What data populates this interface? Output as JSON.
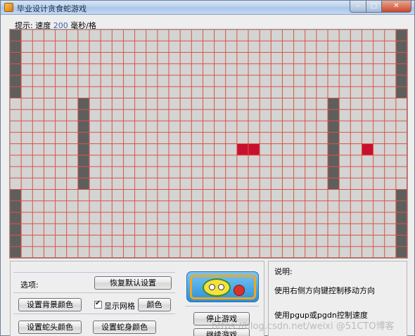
{
  "window": {
    "title": "毕业设计贪食蛇游戏",
    "min_label": "–",
    "max_label": "□",
    "close_label": "✕"
  },
  "status": {
    "prefix": "提示:",
    "speed_label": "速度",
    "speed_value": "200",
    "unit": "毫秒/格"
  },
  "board": {
    "cols": 35,
    "rows": 20,
    "background": "#d4d4d4",
    "grid_color": "#d75545",
    "wall_color": "#5e5e5e",
    "food_color": "#c8102e",
    "show_grid": true,
    "walls": [
      {
        "col": 0,
        "row_start": 0,
        "row_end": 5
      },
      {
        "col": 34,
        "row_start": 0,
        "row_end": 5
      },
      {
        "col": 0,
        "row_start": 14,
        "row_end": 19
      },
      {
        "col": 34,
        "row_start": 14,
        "row_end": 19
      },
      {
        "col": 6,
        "row_start": 6,
        "row_end": 13
      },
      {
        "col": 28,
        "row_start": 6,
        "row_end": 13
      }
    ],
    "red_cells": [
      {
        "col": 20,
        "row": 10
      },
      {
        "col": 21,
        "row": 10
      },
      {
        "col": 31,
        "row": 10
      }
    ]
  },
  "options": {
    "title": "选项:",
    "restore_default": "恢复默认设置",
    "set_bg_color": "设置背景颜色",
    "show_grid_label": "显示网格",
    "color_button": "颜色",
    "set_head_color": "设置蛇头颜色",
    "set_body_color": "设置蛇身颜色"
  },
  "game": {
    "stop_button": "停止游戏",
    "continue_button": "继续游戏"
  },
  "help": {
    "title": "说明:",
    "line1": "使用右侧方向键控制移动方向",
    "line2": "使用pgup或pgdn控制速度"
  },
  "watermark": "https://blog.csdn.net/weixi @51CTO博客"
}
